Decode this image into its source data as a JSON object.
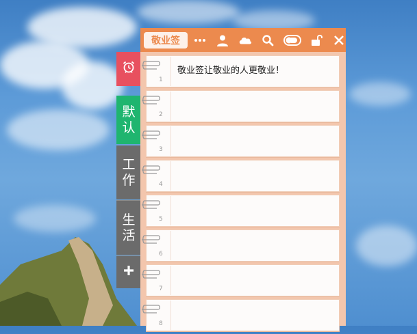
{
  "app": {
    "brand_label": "敬业签"
  },
  "toolbar": {
    "icons": [
      "more-icon",
      "user-icon",
      "cloud-icon",
      "search-icon",
      "toggle-icon",
      "unlock-icon",
      "close-icon"
    ]
  },
  "side_tabs": {
    "alarm_icon": "alarm-clock-icon",
    "default_label": "默\n认",
    "default_line1": "默",
    "default_line2": "认",
    "work_line1": "工",
    "work_line2": "作",
    "life_line1": "生",
    "life_line2": "活",
    "add_label": "+"
  },
  "notes": [
    {
      "num": "1",
      "text": "敬业签让敬业的人更敬业！"
    },
    {
      "num": "2",
      "text": ""
    },
    {
      "num": "3",
      "text": ""
    },
    {
      "num": "4",
      "text": ""
    },
    {
      "num": "5",
      "text": ""
    },
    {
      "num": "6",
      "text": ""
    },
    {
      "num": "7",
      "text": ""
    },
    {
      "num": "8",
      "text": ""
    }
  ],
  "colors": {
    "titlebar": "#ec8a4e",
    "tab_alarm": "#e8505f",
    "tab_default": "#1fb56f",
    "tab_other": "#6b6b6b",
    "panel_bg": "#f3c6ad"
  }
}
